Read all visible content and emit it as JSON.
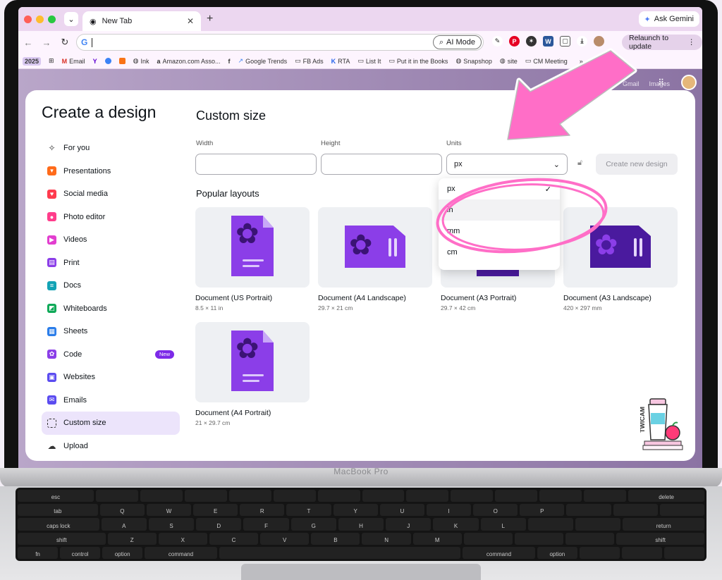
{
  "browser": {
    "tab_title": "New Tab",
    "ask_gemini": "Ask Gemini",
    "omnibox_value": "",
    "ai_mode_label": "AI Mode",
    "relaunch_label": "Relaunch to update",
    "bookmarks": [
      {
        "label": "2025",
        "icon": "year-badge"
      },
      {
        "label": "",
        "icon": "apps-grid-icon"
      },
      {
        "label": "Email",
        "icon": "gmail-icon"
      },
      {
        "label": "",
        "icon": "yahoo-icon"
      },
      {
        "label": "",
        "icon": "globe-icon"
      },
      {
        "label": "",
        "icon": "u-icon"
      },
      {
        "label": "Ink",
        "icon": "globe-icon"
      },
      {
        "label": "Amazon.com Asso...",
        "icon": "amazon-icon"
      },
      {
        "label": "",
        "icon": "facebook-icon"
      },
      {
        "label": "Google Trends",
        "icon": "trends-icon"
      },
      {
        "label": "FB Ads",
        "icon": "folder-icon"
      },
      {
        "label": "RTA",
        "icon": "k-icon"
      },
      {
        "label": "List It",
        "icon": "folder-icon"
      },
      {
        "label": "Put it in the Books",
        "icon": "folder-icon"
      },
      {
        "label": "Snapshop",
        "icon": "globe-icon"
      },
      {
        "label": "site",
        "icon": "globe-icon"
      },
      {
        "label": "CM Meeting",
        "icon": "folder-icon"
      }
    ],
    "bookmarks_more": "»",
    "page_links": [
      "Gmail",
      "Images"
    ]
  },
  "modal": {
    "title": "Create a design",
    "nav": [
      {
        "label": "For you",
        "icon": "sparkle-icon",
        "color": "#3b3b3b"
      },
      {
        "label": "Presentations",
        "icon": "presentation-icon",
        "color": "#ff6b1a"
      },
      {
        "label": "Social media",
        "icon": "heart-icon",
        "color": "#ff3b4e"
      },
      {
        "label": "Photo editor",
        "icon": "camera-icon",
        "color": "#ff3d8b"
      },
      {
        "label": "Videos",
        "icon": "video-icon",
        "color": "#e23ecf"
      },
      {
        "label": "Print",
        "icon": "printer-icon",
        "color": "#8b3ee8"
      },
      {
        "label": "Docs",
        "icon": "doc-icon",
        "color": "#13a3b5"
      },
      {
        "label": "Whiteboards",
        "icon": "whiteboard-icon",
        "color": "#0fa958"
      },
      {
        "label": "Sheets",
        "icon": "sheet-icon",
        "color": "#2b7de9"
      },
      {
        "label": "Code",
        "icon": "code-icon",
        "color": "#8b3ee8",
        "badge": "New"
      },
      {
        "label": "Websites",
        "icon": "website-icon",
        "color": "#5b4cf0"
      },
      {
        "label": "Emails",
        "icon": "mail-icon",
        "color": "#5b4cf0"
      },
      {
        "label": "Custom size",
        "icon": "crop-icon",
        "color": "#3b3b3b"
      },
      {
        "label": "Upload",
        "icon": "upload-icon",
        "color": "#3b3b3b"
      }
    ],
    "custom_size": {
      "title": "Custom size",
      "width_label": "Width",
      "height_label": "Height",
      "units_label": "Units",
      "width_value": "",
      "height_value": "",
      "units_value": "px",
      "create_label": "Create new design"
    },
    "units_options": [
      "px",
      "in",
      "mm",
      "cm"
    ],
    "popular_title": "Popular layouts",
    "layouts": [
      {
        "title": "Document (US Portrait)",
        "size": "8.5 × 11 in"
      },
      {
        "title": "Document (A4 Landscape)",
        "size": "29.7 × 21 cm"
      },
      {
        "title": "Document (A3 Portrait)",
        "size": "29.7 × 42 cm"
      },
      {
        "title": "Document (A3 Landscape)",
        "size": "420 × 297 mm"
      },
      {
        "title": "Document (A4 Portrait)",
        "size": "21 × 29.7 cm"
      }
    ]
  },
  "laptop": {
    "model": "MacBook Pro",
    "sticker": "TWICAM"
  },
  "colors": {
    "accent": "#7d2ae8",
    "annotation_pink": "#ff6ec7"
  }
}
